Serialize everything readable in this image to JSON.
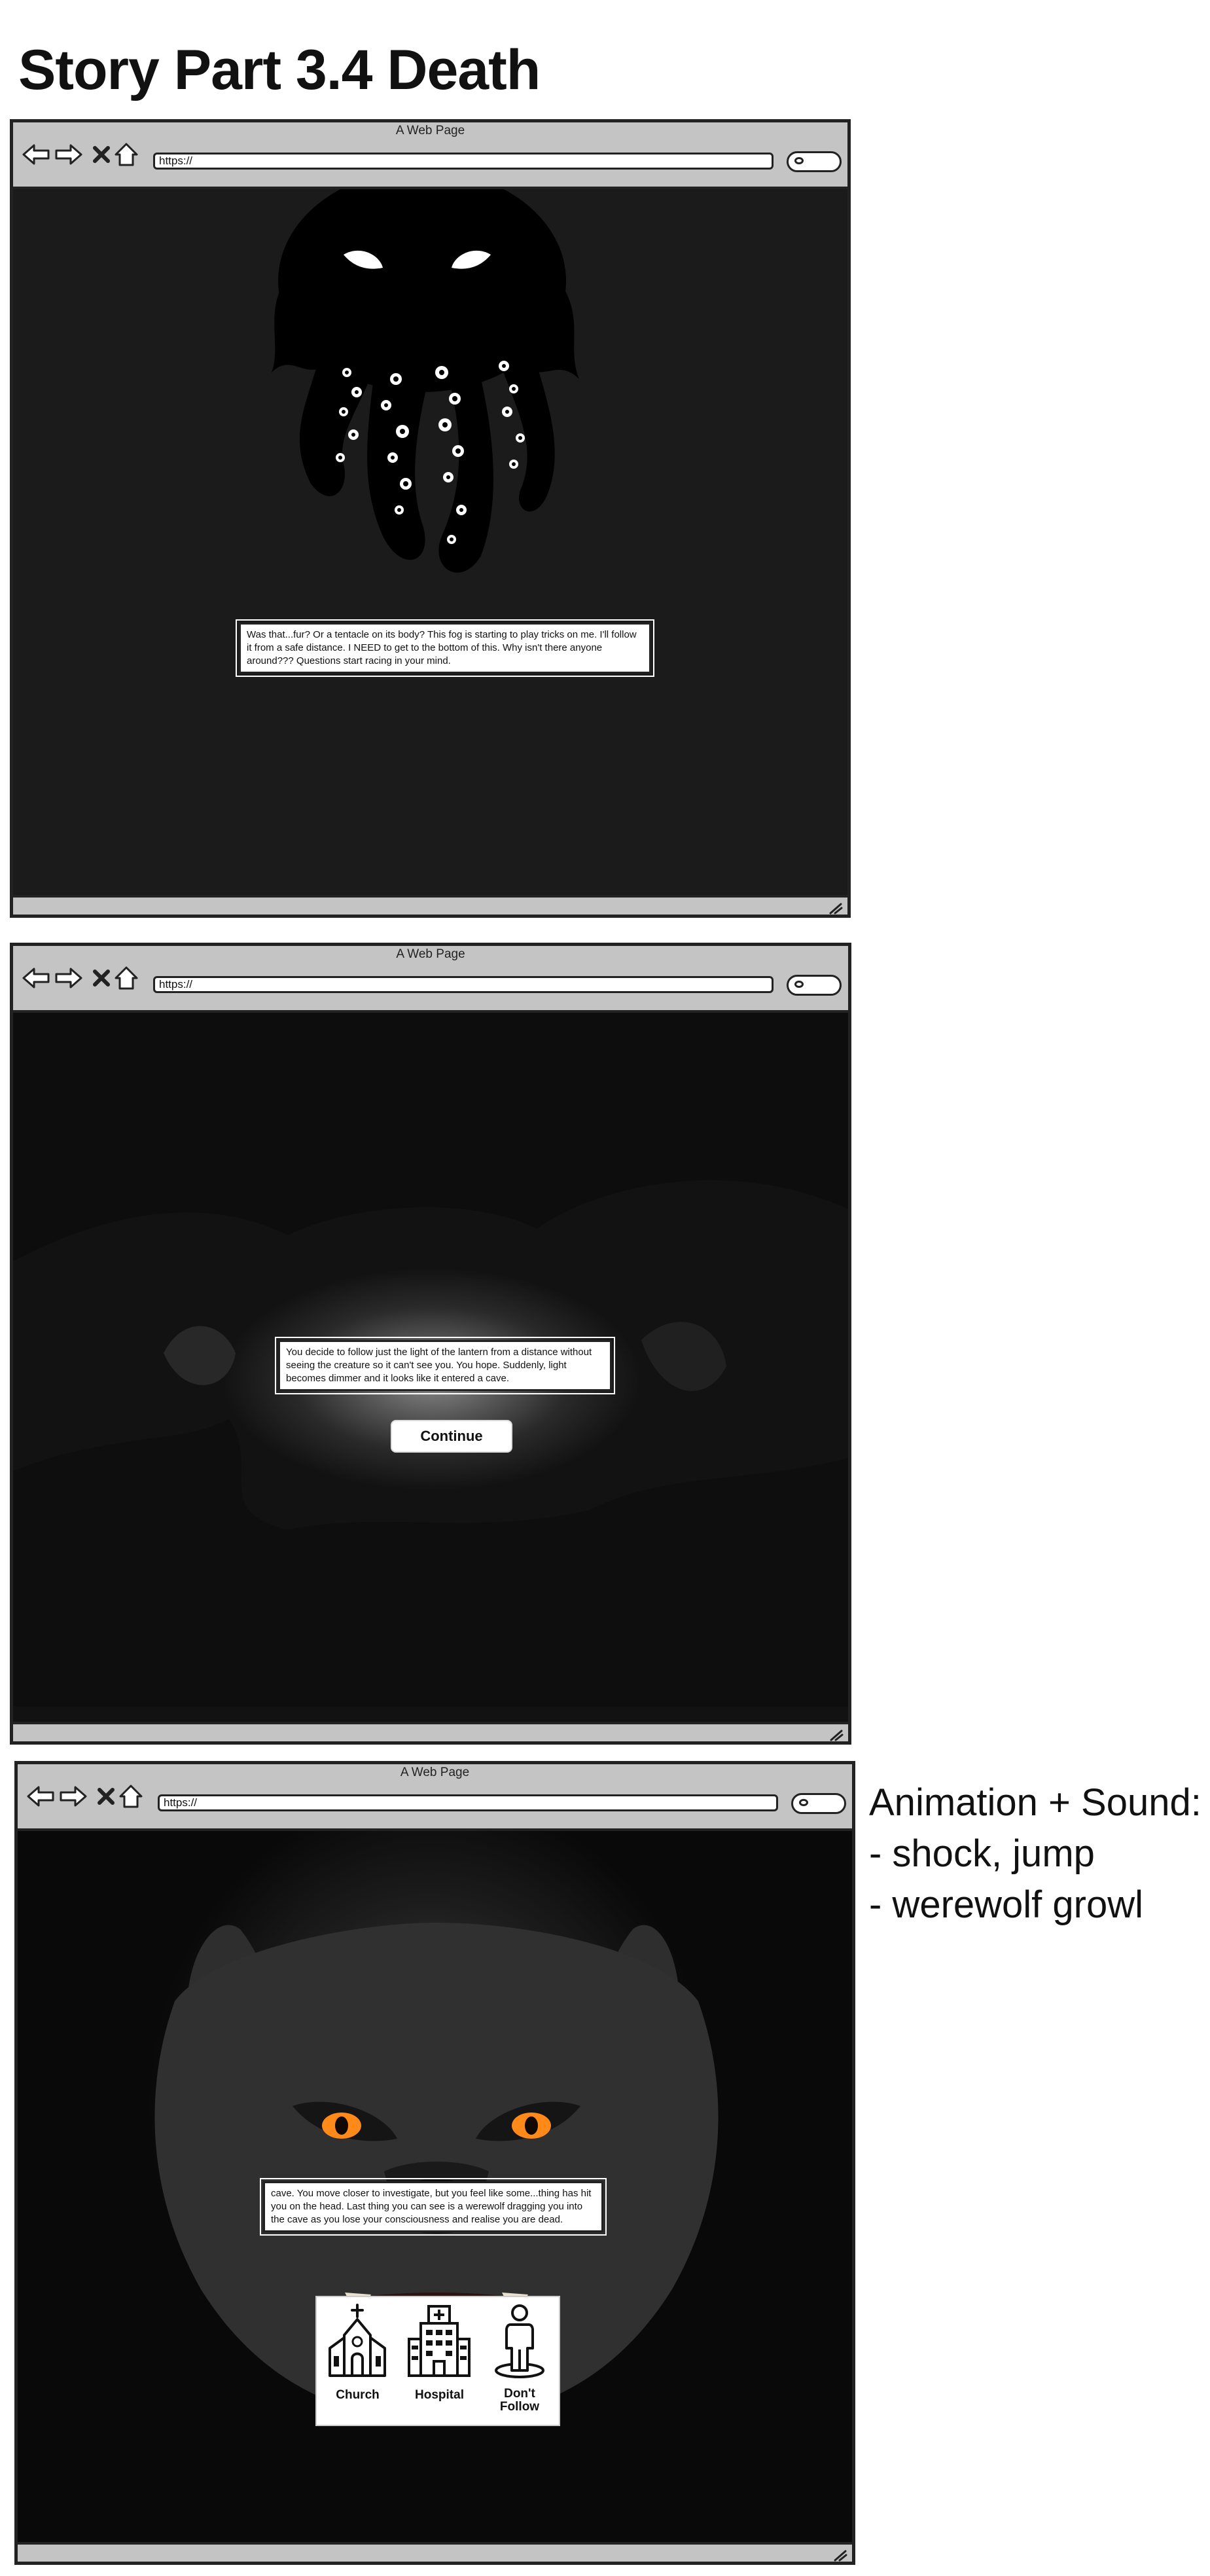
{
  "heading": "Story Part 3.4 Death",
  "browser_chrome": {
    "window_title": "A Web Page",
    "url": "https://",
    "icons": [
      "back-arrow-icon",
      "forward-arrow-icon",
      "close-x-icon",
      "home-icon",
      "search-icon",
      "resize-grip-icon"
    ]
  },
  "screen1": {
    "illustration": "tentacle-creature-icon",
    "text": "Was that...fur? Or a tentacle on its body? This fog is starting to play tricks on me. I'll follow it from a safe distance. I NEED to get to the bottom of this. Why isn't there anyone around??? Questions start racing in your mind."
  },
  "screen2": {
    "background": "dark-cave",
    "text": "You decide to follow just the light of the lantern from a distance without seeing the creature so it can't see you. You hope. Suddenly, light becomes dimmer and it looks like it entered a cave.",
    "continue_label": "Continue"
  },
  "screen3": {
    "background": "werewolf-face",
    "text": "cave. You move closer to investigate, but you feel like some...thing has hit you on the head. Last thing you can see is a werewolf dragging you into the cave as you lose your consciousness and realise you are dead.",
    "choices": [
      {
        "label": "Church",
        "icon": "church-icon"
      },
      {
        "label": "Hospital",
        "icon": "hospital-icon"
      },
      {
        "label": "Don't Follow",
        "icon": "standing-person-icon"
      }
    ]
  },
  "side_note": {
    "title": "Animation + Sound:",
    "items": [
      "- shock, jump",
      "- werewolf growl"
    ]
  },
  "colors": {
    "chrome_gray": "#c4c4c4",
    "outline": "#222222",
    "screen1_bg": "#1b1b1b",
    "wolf_eye": "#ff8a1a"
  }
}
